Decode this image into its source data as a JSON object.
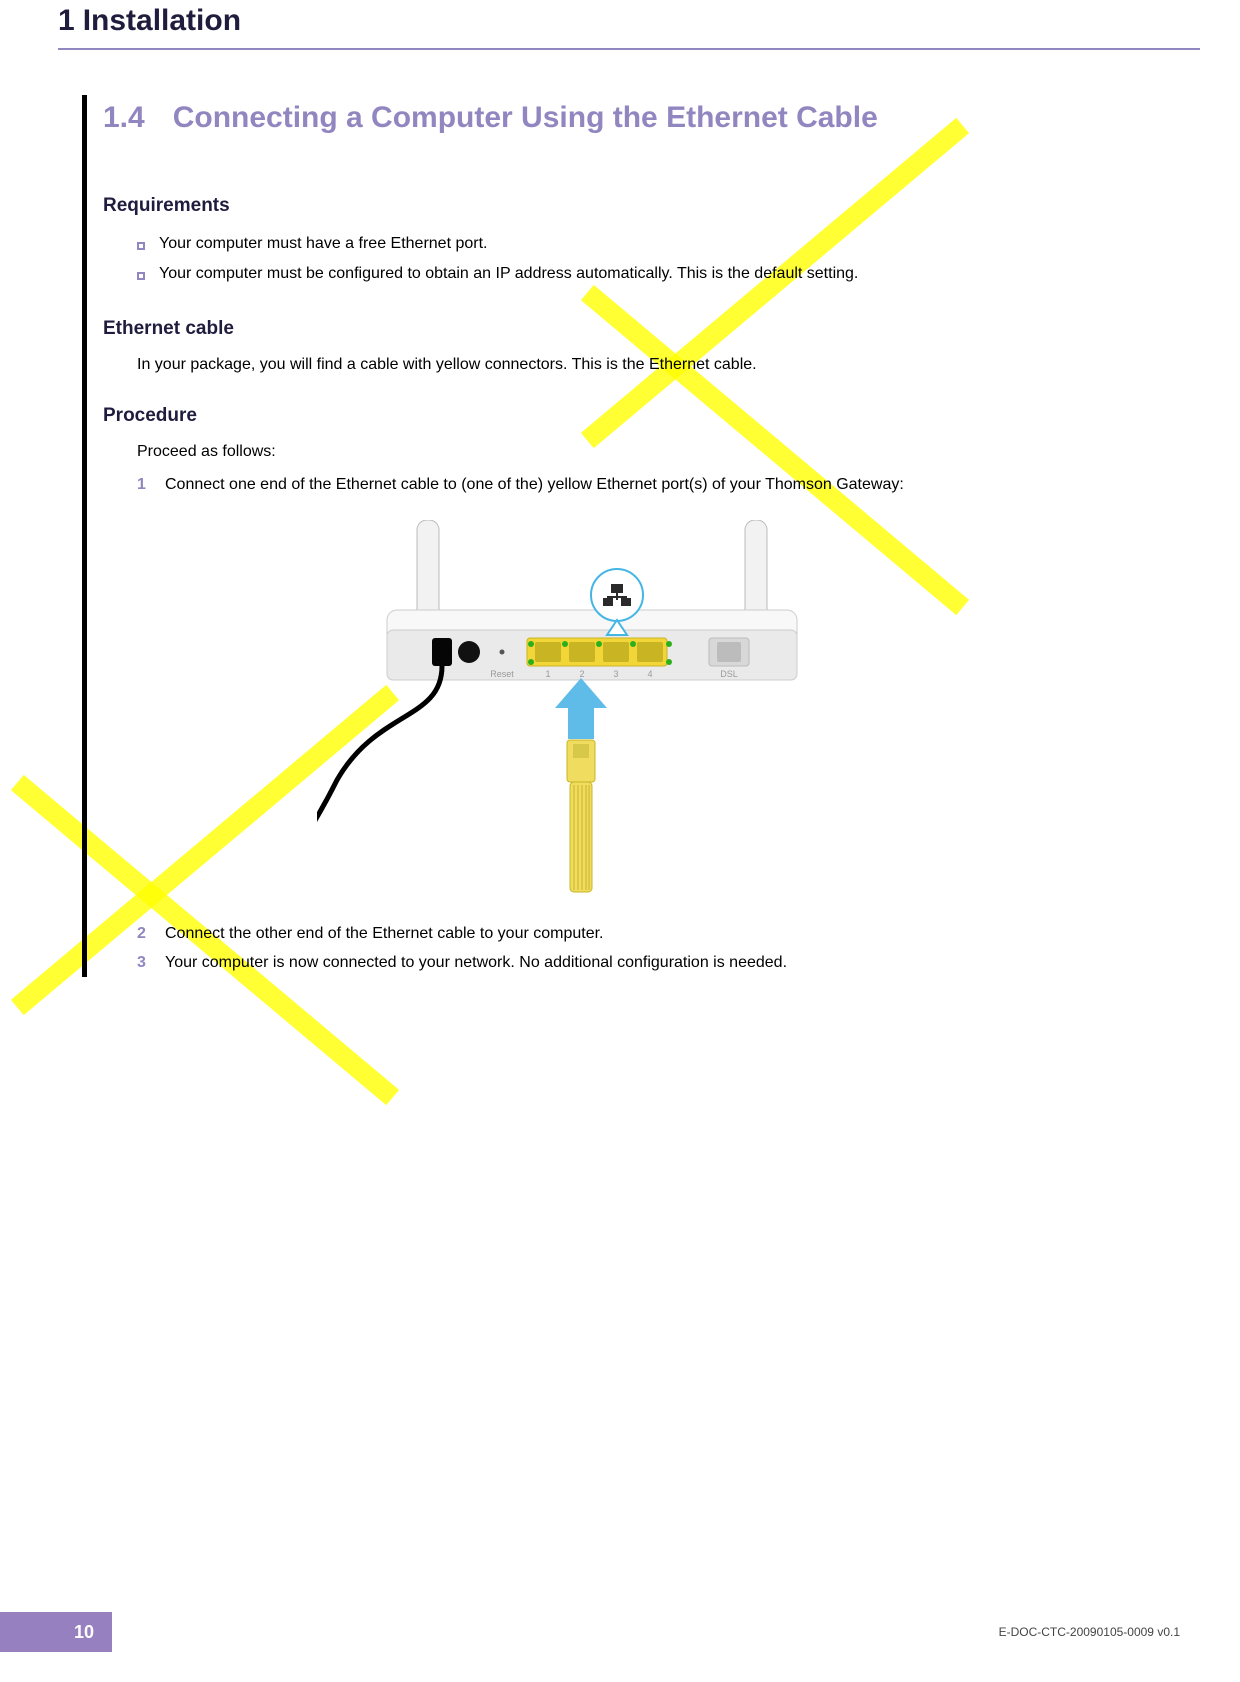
{
  "header": {
    "chapter_num": "1",
    "chapter_title": "Installation"
  },
  "section": {
    "number": "1.4",
    "title": "Connecting a Computer Using the Ethernet Cable"
  },
  "requirements": {
    "heading": "Requirements",
    "items": [
      "Your computer must have a free Ethernet port.",
      "Your computer must be configured to obtain an IP address automatically. This is the default setting."
    ]
  },
  "ethernet_cable": {
    "heading": "Ethernet cable",
    "text": "In your package, you will find a cable with yellow connectors. This is the Ethernet cable."
  },
  "procedure": {
    "heading": "Procedure",
    "intro": "Proceed as follows:",
    "steps": [
      "Connect one end of the Ethernet cable to (one of the) yellow Ethernet port(s) of your Thomson Gateway:",
      "Connect the other end of the Ethernet cable to your computer.",
      "Your computer is now connected to your network. No additional configuration is needed."
    ],
    "step_numbers": [
      "1",
      "2",
      "3"
    ]
  },
  "footer": {
    "page_number": "10",
    "doc_id": "E-DOC-CTC-20090105-0009 v0.1"
  },
  "diagram": {
    "port_labels": [
      "1",
      "2",
      "3",
      "4"
    ],
    "reset_label": "Reset",
    "dsl_label": "DSL"
  }
}
